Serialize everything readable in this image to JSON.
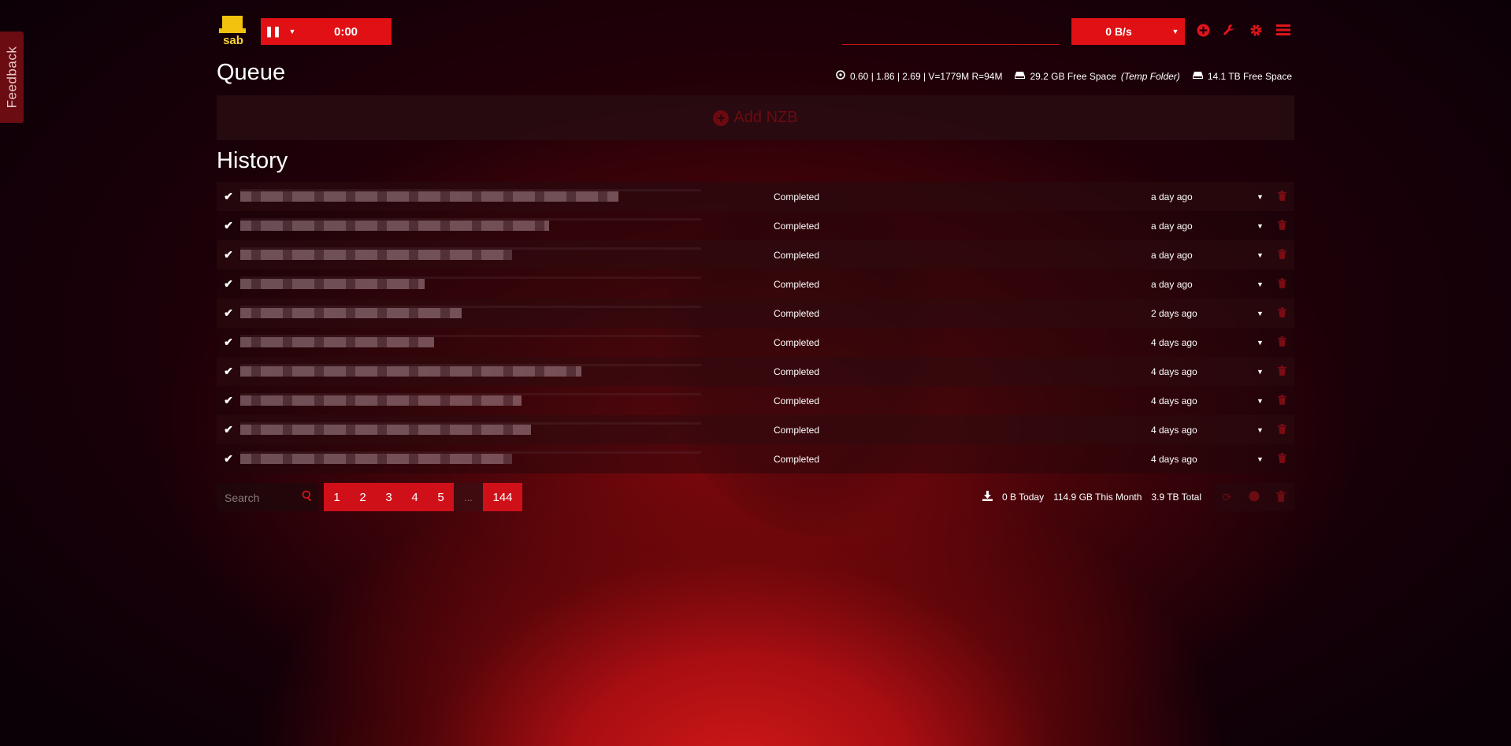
{
  "sidebar": {
    "feedback_label": "Feedback"
  },
  "header": {
    "logo_text": "sab",
    "pause_icon": "pause-icon",
    "timer": "0:00",
    "speed": "0 B/s",
    "icons": [
      "add-circle-icon",
      "wrench-icon",
      "gear-icon",
      "hamburger-menu-icon"
    ]
  },
  "queue": {
    "title": "Queue",
    "sysload": "0.60 | 1.86 | 2.69 | V=1779M R=94M",
    "temp_space": "29.2 GB Free Space",
    "temp_folder_label": "(Temp Folder)",
    "free_space": "14.1 TB Free Space",
    "add_nzb_label": "Add NZB"
  },
  "history": {
    "title": "History",
    "rows": [
      {
        "status": "Completed",
        "when": "a day ago",
        "name_fill": 0.82
      },
      {
        "status": "Completed",
        "when": "a day ago",
        "name_fill": 0.67
      },
      {
        "status": "Completed",
        "when": "a day ago",
        "name_fill": 0.59
      },
      {
        "status": "Completed",
        "when": "a day ago",
        "name_fill": 0.4
      },
      {
        "status": "Completed",
        "when": "2 days ago",
        "name_fill": 0.48
      },
      {
        "status": "Completed",
        "when": "4 days ago",
        "name_fill": 0.42
      },
      {
        "status": "Completed",
        "when": "4 days ago",
        "name_fill": 0.74
      },
      {
        "status": "Completed",
        "when": "4 days ago",
        "name_fill": 0.61
      },
      {
        "status": "Completed",
        "when": "4 days ago",
        "name_fill": 0.63
      },
      {
        "status": "Completed",
        "when": "4 days ago",
        "name_fill": 0.59
      }
    ]
  },
  "footer": {
    "search_placeholder": "Search",
    "pages": [
      "1",
      "2",
      "3",
      "4",
      "5"
    ],
    "ellipsis": "...",
    "last_page": "144",
    "today": "0 B Today",
    "month": "114.9 GB This Month",
    "total": "3.9 TB Total"
  }
}
